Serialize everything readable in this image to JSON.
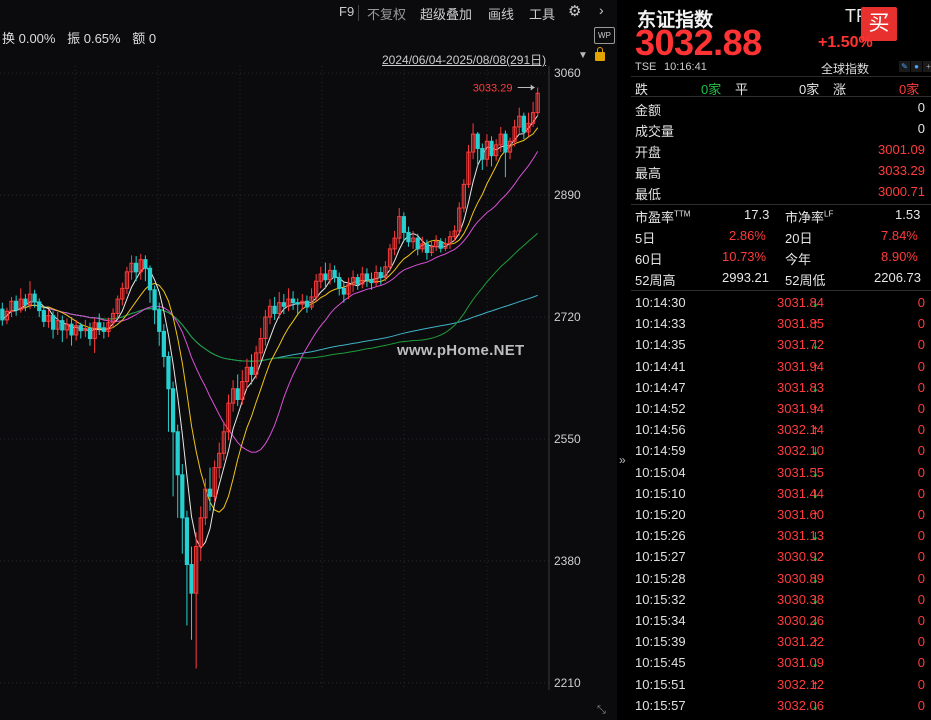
{
  "toolbar": {
    "items": [
      "F9",
      "不复权",
      "超级叠加",
      "画线",
      "工具"
    ],
    "gear_icon": "gear-icon",
    "next_icon": "chevron-right-icon"
  },
  "stats": {
    "turnover": "换 0.00%",
    "amplitude": "振 0.65%",
    "amount": "额 0"
  },
  "date_range": "2024/06/04-2025/08/08(291日)",
  "watermark": "www.pHome.NET",
  "chart_data": {
    "type": "candlestick",
    "ylim": [
      2200,
      3070
    ],
    "y_ticks": [
      3060,
      2890,
      2720,
      2550,
      2380,
      2210
    ],
    "high_annotation": "3033.29",
    "candles": [
      [
        2731,
        2716,
        2740,
        2708
      ],
      [
        2716,
        2728,
        2733,
        2710
      ],
      [
        2728,
        2742,
        2748,
        2720
      ],
      [
        2742,
        2730,
        2750,
        2722
      ],
      [
        2730,
        2745,
        2760,
        2726
      ],
      [
        2745,
        2737,
        2752,
        2728
      ],
      [
        2737,
        2752,
        2770,
        2731
      ],
      [
        2752,
        2741,
        2758,
        2733
      ],
      [
        2741,
        2729,
        2746,
        2720
      ],
      [
        2729,
        2714,
        2735,
        2706
      ],
      [
        2714,
        2722,
        2730,
        2705
      ],
      [
        2722,
        2703,
        2728,
        2690
      ],
      [
        2703,
        2715,
        2727,
        2695
      ],
      [
        2715,
        2702,
        2722,
        2685
      ],
      [
        2702,
        2710,
        2718,
        2690
      ],
      [
        2710,
        2695,
        2720,
        2680
      ],
      [
        2695,
        2708,
        2716,
        2687
      ],
      [
        2708,
        2701,
        2712,
        2690
      ],
      [
        2701,
        2704,
        2716,
        2692
      ],
      [
        2704,
        2690,
        2712,
        2680
      ],
      [
        2690,
        2712,
        2718,
        2670
      ],
      [
        2712,
        2705,
        2725,
        2695
      ],
      [
        2705,
        2700,
        2713,
        2690
      ],
      [
        2700,
        2712,
        2719,
        2692
      ],
      [
        2712,
        2725,
        2732,
        2705
      ],
      [
        2725,
        2745,
        2750,
        2718
      ],
      [
        2745,
        2760,
        2768,
        2736
      ],
      [
        2760,
        2783,
        2790,
        2752
      ],
      [
        2783,
        2795,
        2806,
        2772
      ],
      [
        2795,
        2783,
        2805,
        2770
      ],
      [
        2783,
        2800,
        2808,
        2772
      ],
      [
        2800,
        2788,
        2806,
        2770
      ],
      [
        2788,
        2758,
        2792,
        2740
      ],
      [
        2758,
        2730,
        2764,
        2710
      ],
      [
        2730,
        2700,
        2740,
        2680
      ],
      [
        2700,
        2665,
        2710,
        2650
      ],
      [
        2665,
        2620,
        2672,
        2560
      ],
      [
        2620,
        2560,
        2630,
        2470
      ],
      [
        2560,
        2500,
        2570,
        2440
      ],
      [
        2500,
        2440,
        2515,
        2390
      ],
      [
        2440,
        2375,
        2450,
        2290
      ],
      [
        2375,
        2335,
        2400,
        2270
      ],
      [
        2335,
        2400,
        2420,
        2230
      ],
      [
        2400,
        2440,
        2456,
        2380
      ],
      [
        2440,
        2480,
        2495,
        2430
      ],
      [
        2480,
        2470,
        2510,
        2450
      ],
      [
        2470,
        2510,
        2520,
        2462
      ],
      [
        2510,
        2530,
        2545,
        2495
      ],
      [
        2530,
        2560,
        2574,
        2520
      ],
      [
        2560,
        2600,
        2612,
        2548
      ],
      [
        2600,
        2620,
        2632,
        2588
      ],
      [
        2620,
        2605,
        2640,
        2596
      ],
      [
        2605,
        2630,
        2646,
        2598
      ],
      [
        2630,
        2650,
        2662,
        2620
      ],
      [
        2650,
        2640,
        2668,
        2626
      ],
      [
        2640,
        2670,
        2680,
        2634
      ],
      [
        2670,
        2690,
        2705,
        2660
      ],
      [
        2690,
        2720,
        2730,
        2680
      ],
      [
        2720,
        2735,
        2745,
        2710
      ],
      [
        2735,
        2725,
        2748,
        2716
      ],
      [
        2725,
        2740,
        2755,
        2718
      ],
      [
        2740,
        2735,
        2752,
        2724
      ],
      [
        2735,
        2745,
        2760,
        2728
      ],
      [
        2745,
        2740,
        2756,
        2730
      ],
      [
        2740,
        2738,
        2746,
        2722
      ],
      [
        2738,
        2742,
        2752,
        2730
      ],
      [
        2742,
        2734,
        2750,
        2726
      ],
      [
        2734,
        2748,
        2760,
        2730
      ],
      [
        2748,
        2770,
        2780,
        2742
      ],
      [
        2770,
        2780,
        2790,
        2760
      ],
      [
        2780,
        2772,
        2796,
        2760
      ],
      [
        2772,
        2785,
        2795,
        2765
      ],
      [
        2785,
        2775,
        2792,
        2768
      ],
      [
        2775,
        2760,
        2782,
        2750
      ],
      [
        2760,
        2752,
        2768,
        2740
      ],
      [
        2752,
        2765,
        2775,
        2745
      ],
      [
        2765,
        2775,
        2785,
        2755
      ],
      [
        2775,
        2766,
        2780,
        2758
      ],
      [
        2766,
        2780,
        2790,
        2760
      ],
      [
        2780,
        2772,
        2788,
        2762
      ],
      [
        2772,
        2768,
        2782,
        2758
      ],
      [
        2768,
        2782,
        2792,
        2762
      ],
      [
        2782,
        2775,
        2790,
        2765
      ],
      [
        2775,
        2790,
        2798,
        2770
      ],
      [
        2790,
        2815,
        2822,
        2784
      ],
      [
        2815,
        2830,
        2840,
        2806
      ],
      [
        2830,
        2860,
        2872,
        2822
      ],
      [
        2860,
        2838,
        2866,
        2826
      ],
      [
        2838,
        2825,
        2846,
        2818
      ],
      [
        2825,
        2830,
        2840,
        2815
      ],
      [
        2830,
        2815,
        2836,
        2806
      ],
      [
        2815,
        2822,
        2832,
        2810
      ],
      [
        2822,
        2810,
        2828,
        2800
      ],
      [
        2810,
        2818,
        2826,
        2805
      ],
      [
        2818,
        2825,
        2834,
        2812
      ],
      [
        2825,
        2816,
        2830,
        2810
      ],
      [
        2816,
        2822,
        2830,
        2812
      ],
      [
        2822,
        2832,
        2840,
        2815
      ],
      [
        2832,
        2840,
        2848,
        2826
      ],
      [
        2840,
        2872,
        2880,
        2834
      ],
      [
        2872,
        2905,
        2912,
        2866
      ],
      [
        2905,
        2950,
        2960,
        2900
      ],
      [
        2950,
        2975,
        2990,
        2940
      ],
      [
        2975,
        2955,
        2978,
        2930
      ],
      [
        2955,
        2940,
        2962,
        2925
      ],
      [
        2940,
        2965,
        2975,
        2930
      ],
      [
        2965,
        2945,
        2972,
        2930
      ],
      [
        2945,
        2960,
        2968,
        2938
      ],
      [
        2960,
        2975,
        2985,
        2950
      ],
      [
        2975,
        2950,
        2980,
        2915
      ],
      [
        2950,
        2965,
        2970,
        2940
      ],
      [
        2965,
        2985,
        2995,
        2958
      ],
      [
        2985,
        3000,
        3012,
        2975
      ],
      [
        3000,
        2978,
        3005,
        2968
      ],
      [
        2978,
        2990,
        3005,
        2972
      ],
      [
        2990,
        3005,
        3020,
        2985
      ],
      [
        3005,
        3032,
        3040,
        3000
      ]
    ],
    "ma_lines": [
      {
        "name": "MA5",
        "color": "#e8e8e8"
      },
      {
        "name": "MA10",
        "color": "#f0c419"
      },
      {
        "name": "MA20",
        "color": "#d84fd6"
      },
      {
        "name": "MA60",
        "color": "#1e9c3a"
      },
      {
        "name": "MA120",
        "color": "#3fb3c8"
      }
    ]
  },
  "quote": {
    "name": "东证指数",
    "code": "TPX",
    "buy_label": "买",
    "price": "3032.88",
    "change_pct": "+1.50%",
    "exchange": "TSE",
    "time": "10:16:41",
    "global_index": "全球指数",
    "adv": {
      "fall_label": "跌",
      "fall_val": "0家",
      "flat_label": "平",
      "flat_val": "0家",
      "rise_label": "涨",
      "rise_val": "0家"
    },
    "amount_label": "金额",
    "amount": "0",
    "volume_label": "成交量",
    "volume": "0",
    "open_label": "开盘",
    "open": "3001.09",
    "high_label": "最高",
    "high": "3033.29",
    "low_label": "最低",
    "low": "3000.71",
    "pe_label": "市盈率",
    "pe_sup": "TTM",
    "pe": "17.3",
    "pb_label": "市净率",
    "pb_sup": "LF",
    "pb": "1.53",
    "d5_label": "5日",
    "d5": "2.86%",
    "d20_label": "20日",
    "d20": "7.84%",
    "d60_label": "60日",
    "d60": "10.73%",
    "ytd_label": "今年",
    "ytd": "8.90%",
    "w52h_label": "52周高",
    "w52h": "2993.21",
    "w52l_label": "52周低",
    "w52l": "2206.73"
  },
  "ticks": [
    {
      "time": "10:14:30",
      "price": "3031.84",
      "dir": "down",
      "vol": "0"
    },
    {
      "time": "10:14:33",
      "price": "3031.85",
      "dir": "up",
      "vol": "0"
    },
    {
      "time": "10:14:35",
      "price": "3031.72",
      "dir": "down",
      "vol": "0"
    },
    {
      "time": "10:14:41",
      "price": "3031.94",
      "dir": "up",
      "vol": "0"
    },
    {
      "time": "10:14:47",
      "price": "3031.83",
      "dir": "down",
      "vol": "0"
    },
    {
      "time": "10:14:52",
      "price": "3031.94",
      "dir": "up",
      "vol": "0"
    },
    {
      "time": "10:14:56",
      "price": "3032.14",
      "dir": "up",
      "vol": "0"
    },
    {
      "time": "10:14:59",
      "price": "3032.10",
      "dir": "down",
      "vol": "0"
    },
    {
      "time": "10:15:04",
      "price": "3031.55",
      "dir": "down",
      "vol": "0"
    },
    {
      "time": "10:15:10",
      "price": "3031.44",
      "dir": "down",
      "vol": "0"
    },
    {
      "time": "10:15:20",
      "price": "3031.60",
      "dir": "up",
      "vol": "0"
    },
    {
      "time": "10:15:26",
      "price": "3031.13",
      "dir": "down",
      "vol": "0"
    },
    {
      "time": "10:15:27",
      "price": "3030.92",
      "dir": "down",
      "vol": "0"
    },
    {
      "time": "10:15:28",
      "price": "3030.89",
      "dir": "down",
      "vol": "0"
    },
    {
      "time": "10:15:32",
      "price": "3030.38",
      "dir": "down",
      "vol": "0"
    },
    {
      "time": "10:15:34",
      "price": "3030.26",
      "dir": "down",
      "vol": "0"
    },
    {
      "time": "10:15:39",
      "price": "3031.22",
      "dir": "up",
      "vol": "0"
    },
    {
      "time": "10:15:45",
      "price": "3031.09",
      "dir": "down",
      "vol": "0"
    },
    {
      "time": "10:15:51",
      "price": "3032.12",
      "dir": "up",
      "vol": "0"
    },
    {
      "time": "10:15:57",
      "price": "3032.06",
      "dir": "down",
      "vol": "0"
    }
  ]
}
